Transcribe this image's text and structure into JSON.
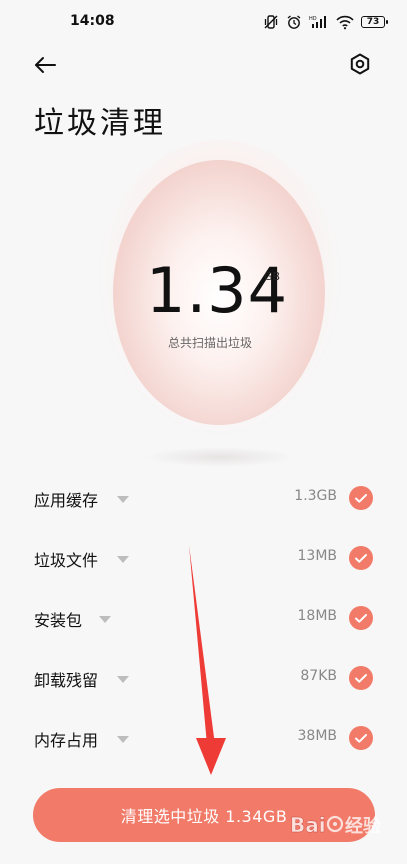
{
  "status_bar": {
    "time": "14:08",
    "battery_level": "73",
    "icons": [
      "mute-vibrate-icon",
      "alarm-icon",
      "hd-signal-icon",
      "wifi-icon",
      "battery-icon"
    ]
  },
  "header": {
    "back_icon": "back-arrow-icon",
    "settings_icon": "hexagon-settings-icon",
    "title": "垃圾清理"
  },
  "summary": {
    "total_value": "1.34",
    "total_unit": "GB",
    "caption": "总共扫描出垃圾"
  },
  "items": [
    {
      "label": "应用缓存",
      "size": "1.3GB",
      "checked": true
    },
    {
      "label": "垃圾文件",
      "size": "13MB",
      "checked": true
    },
    {
      "label": "安装包",
      "size": "18MB",
      "checked": true
    },
    {
      "label": "卸载残留",
      "size": "87KB",
      "checked": true
    },
    {
      "label": "内存占用",
      "size": "38MB",
      "checked": true
    }
  ],
  "action": {
    "clean_button_label": "清理选中垃圾 1.34GB"
  },
  "colors": {
    "accent": "#f17a68",
    "background": "#f7f7f7",
    "annotation_arrow": "#ef3b36"
  }
}
